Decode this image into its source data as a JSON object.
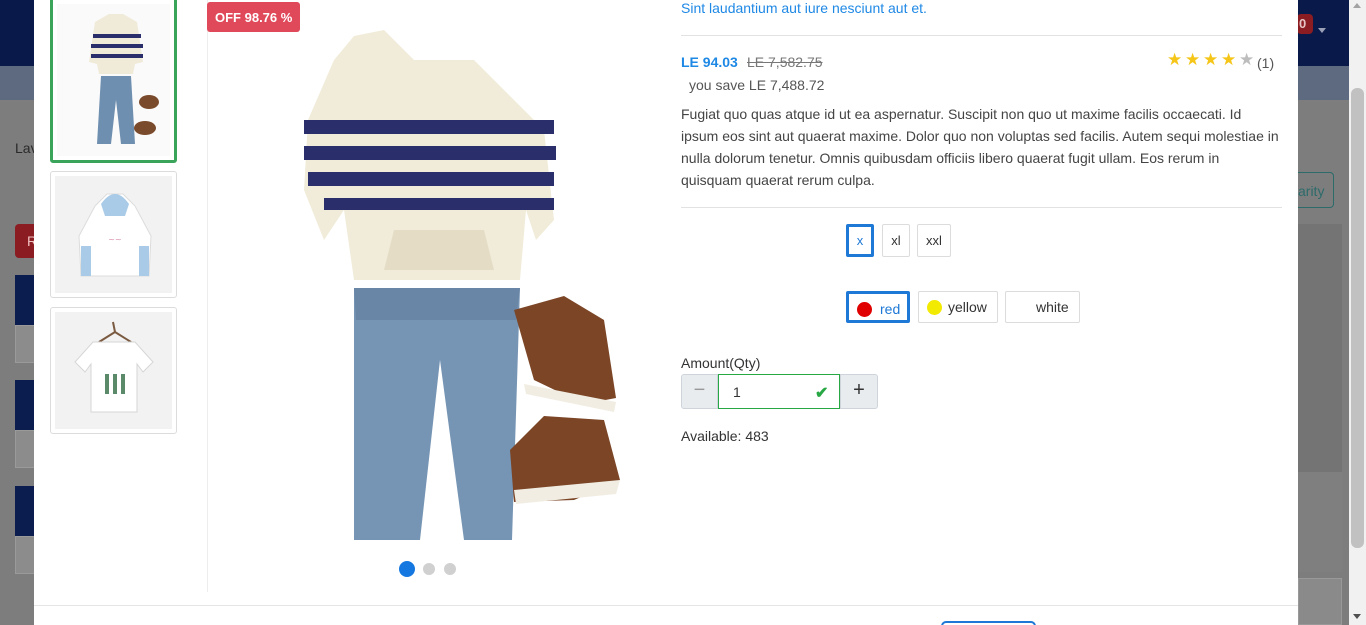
{
  "background_page": {
    "left_text": "Lav",
    "left_red_text": "R",
    "right_button_text": "arity",
    "cart_badge": "0"
  },
  "product": {
    "subtitle": "Sint laudantium aut iure nesciunt aut et.",
    "discount_badge": "OFF 98.76 %",
    "price": "LE 94.03",
    "old_price": "LE 7,582.75",
    "you_save": "you save LE 7,488.72",
    "rating_stars": 4,
    "rating_max": 5,
    "rating_count": "(1)",
    "description": "Fugiat quo quas atque id ut ea aspernatur. Suscipit non quo ut maxime facilis occaecati. Id ipsum eos sint aut quaerat maxime. Dolor quo non voluptas sed facilis. Autem sequi molestiae in nulla dolorum tenetur. Omnis quibusdam officiis libero quaerat fugit ullam. Eos rerum in quisquam quaerat rerum culpa.",
    "sizes": [
      "x",
      "xl",
      "xxl"
    ],
    "selected_size": "x",
    "colors": [
      {
        "label": "red",
        "swatch": "#e00000"
      },
      {
        "label": "yellow",
        "swatch": "#f2ea00"
      },
      {
        "label": "white",
        "swatch": "#ffffff"
      }
    ],
    "selected_color": "red",
    "quantity_label": "Amount(Qty)",
    "quantity_value": "1",
    "available": "Available: 483"
  },
  "gallery": {
    "thumbnails": [
      "striped-hoodie-outfit",
      "blue-bunny-hoodie",
      "white-tshirt-on-hanger"
    ],
    "active_index": 0,
    "slide_count": 3
  },
  "colors": {
    "accent": "#1e88e5",
    "badge": "#e0495a",
    "active_thumb": "#3aa55a",
    "star": "#f5c518"
  }
}
